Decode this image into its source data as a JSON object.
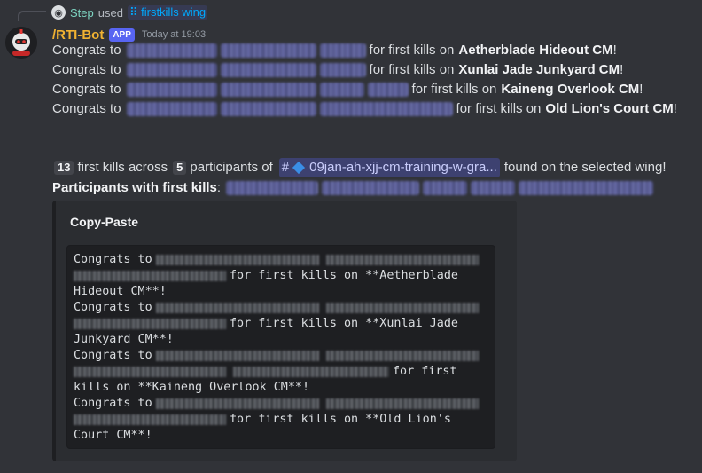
{
  "reply": {
    "step_label": "Step",
    "used_text": "used",
    "command": "firstkills wing"
  },
  "author": {
    "username": "/RTI-Bot",
    "badge": "APP",
    "timestamp": "Today at 19:03"
  },
  "congrats_lines": [
    {
      "prefix": "Congrats to",
      "suffix": "for first kills on",
      "location": "Aetherblade Hideout CM",
      "end": "!"
    },
    {
      "prefix": "Congrats to",
      "suffix": "for first kills on",
      "location": "Xunlai Jade Junkyard CM",
      "end": "!"
    },
    {
      "prefix": "Congrats to",
      "suffix": "for first kills on",
      "location": "Kaineng Overlook CM",
      "end": "!"
    },
    {
      "prefix": "Congrats to",
      "suffix": "for first kills on",
      "location": "Old Lion's Court CM",
      "end": "!"
    }
  ],
  "summary": {
    "kills_count": "13",
    "text1": "first kills across",
    "participants_count": "5",
    "text2": "participants of",
    "channel_hash": "#",
    "channel_name": "09jan-ah-xjj-cm-training-w-gra...",
    "text3": "found on the selected wing!"
  },
  "participants_label": "Participants with first kills",
  "participants_colon": ":",
  "embed": {
    "title": "Copy-Paste",
    "lines": [
      {
        "a": "Congrats to",
        "b": "",
        "c": ""
      },
      {
        "a": "",
        "b": "for first kills on **Aetherblade",
        "c": ""
      },
      {
        "a": "Hideout CM**!",
        "b": "",
        "c": ""
      },
      {
        "a": "Congrats to",
        "b": "",
        "c": ""
      },
      {
        "a": "",
        "b": "for first kills on **Xunlai Jade",
        "c": ""
      },
      {
        "a": "Junkyard CM**!",
        "b": "",
        "c": ""
      },
      {
        "a": "Congrats to",
        "b": "",
        "c": ""
      },
      {
        "a": "",
        "b": "for first",
        "c": ""
      },
      {
        "a": "kills on **Kaineng Overlook CM**!",
        "b": "",
        "c": ""
      },
      {
        "a": "Congrats to",
        "b": "",
        "c": ""
      },
      {
        "a": "",
        "b": "for first kills on **Old Lion's",
        "c": ""
      },
      {
        "a": "Court CM**!",
        "b": "",
        "c": ""
      }
    ]
  },
  "colors": {
    "background": "#313338",
    "username": "#f0b232",
    "app_badge": "#5865f2",
    "embed_bg": "#2b2d31",
    "code_bg": "#1e1f22"
  }
}
